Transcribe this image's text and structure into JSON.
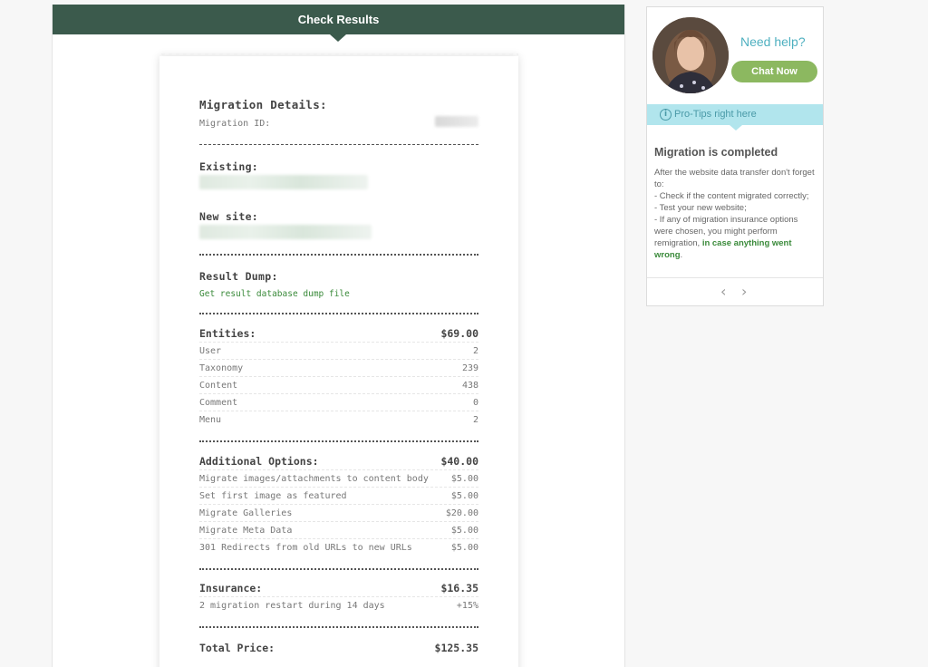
{
  "header": {
    "title": "Check Results"
  },
  "receipt": {
    "migration_details_title": "Migration Details:",
    "migration_id_label": "Migration ID:",
    "existing_label": "Existing:",
    "new_site_label": "New site:",
    "result_dump_label": "Result Dump:",
    "result_dump_link": "Get result database dump file",
    "entities": {
      "title": "Entities:",
      "total": "$69.00",
      "rows": [
        {
          "label": "User",
          "value": "2"
        },
        {
          "label": "Taxonomy",
          "value": "239"
        },
        {
          "label": "Content",
          "value": "438"
        },
        {
          "label": "Comment",
          "value": "0"
        },
        {
          "label": "Menu",
          "value": "2"
        }
      ]
    },
    "additional": {
      "title": "Additional Options:",
      "total": "$40.00",
      "rows": [
        {
          "label": "Migrate images/attachments to content body",
          "value": "$5.00"
        },
        {
          "label": "Set first image as featured",
          "value": "$5.00"
        },
        {
          "label": "Migrate Galleries",
          "value": "$20.00"
        },
        {
          "label": "Migrate Meta Data",
          "value": "$5.00"
        },
        {
          "label": "301 Redirects from old URLs to new URLs",
          "value": "$5.00"
        }
      ]
    },
    "insurance": {
      "title": "Insurance:",
      "total": "$16.35",
      "rows": [
        {
          "label": "2 migration restart during 14 days",
          "value": "+15%"
        }
      ]
    },
    "total": {
      "label": "Total Price:",
      "value": "$125.35"
    }
  },
  "sidebar": {
    "need_help": "Need help?",
    "chat_button": "Chat Now",
    "pro_tips": "Pro-Tips right here",
    "tip_title": "Migration is completed",
    "tip_lines": [
      "After the website data transfer don't forget to:",
      "- Check if the content migrated correctly;",
      "- Test your new website;",
      "- If any of migration insurance options were chosen, you might perform remigration,"
    ],
    "tip_highlight": "in case anything went wrong",
    "tip_end": ".",
    "prev_icon": "chevron-left-icon",
    "next_icon": "chevron-right-icon"
  },
  "colors": {
    "header": "#3b5a4c",
    "chat_button": "#8cb860",
    "tips_bar": "#b1e5ed",
    "link_green": "#3a8a3a",
    "help_text": "#4fb0c0"
  }
}
